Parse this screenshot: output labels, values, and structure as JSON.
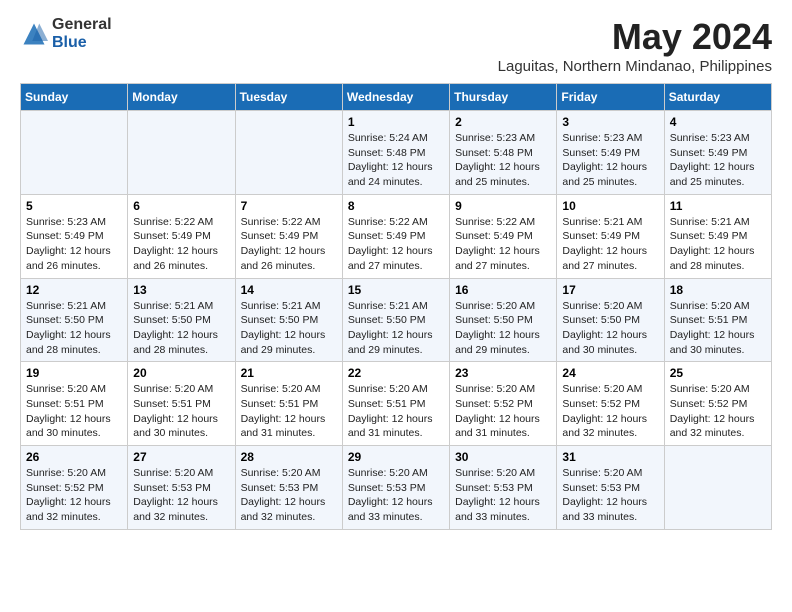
{
  "header": {
    "logo_general": "General",
    "logo_blue": "Blue",
    "month_title": "May 2024",
    "location": "Laguitas, Northern Mindanao, Philippines"
  },
  "days_of_week": [
    "Sunday",
    "Monday",
    "Tuesday",
    "Wednesday",
    "Thursday",
    "Friday",
    "Saturday"
  ],
  "weeks": [
    [
      {
        "day": "",
        "info": ""
      },
      {
        "day": "",
        "info": ""
      },
      {
        "day": "",
        "info": ""
      },
      {
        "day": "1",
        "info": "Sunrise: 5:24 AM\nSunset: 5:48 PM\nDaylight: 12 hours and 24 minutes."
      },
      {
        "day": "2",
        "info": "Sunrise: 5:23 AM\nSunset: 5:48 PM\nDaylight: 12 hours and 25 minutes."
      },
      {
        "day": "3",
        "info": "Sunrise: 5:23 AM\nSunset: 5:49 PM\nDaylight: 12 hours and 25 minutes."
      },
      {
        "day": "4",
        "info": "Sunrise: 5:23 AM\nSunset: 5:49 PM\nDaylight: 12 hours and 25 minutes."
      }
    ],
    [
      {
        "day": "5",
        "info": "Sunrise: 5:23 AM\nSunset: 5:49 PM\nDaylight: 12 hours and 26 minutes."
      },
      {
        "day": "6",
        "info": "Sunrise: 5:22 AM\nSunset: 5:49 PM\nDaylight: 12 hours and 26 minutes."
      },
      {
        "day": "7",
        "info": "Sunrise: 5:22 AM\nSunset: 5:49 PM\nDaylight: 12 hours and 26 minutes."
      },
      {
        "day": "8",
        "info": "Sunrise: 5:22 AM\nSunset: 5:49 PM\nDaylight: 12 hours and 27 minutes."
      },
      {
        "day": "9",
        "info": "Sunrise: 5:22 AM\nSunset: 5:49 PM\nDaylight: 12 hours and 27 minutes."
      },
      {
        "day": "10",
        "info": "Sunrise: 5:21 AM\nSunset: 5:49 PM\nDaylight: 12 hours and 27 minutes."
      },
      {
        "day": "11",
        "info": "Sunrise: 5:21 AM\nSunset: 5:49 PM\nDaylight: 12 hours and 28 minutes."
      }
    ],
    [
      {
        "day": "12",
        "info": "Sunrise: 5:21 AM\nSunset: 5:50 PM\nDaylight: 12 hours and 28 minutes."
      },
      {
        "day": "13",
        "info": "Sunrise: 5:21 AM\nSunset: 5:50 PM\nDaylight: 12 hours and 28 minutes."
      },
      {
        "day": "14",
        "info": "Sunrise: 5:21 AM\nSunset: 5:50 PM\nDaylight: 12 hours and 29 minutes."
      },
      {
        "day": "15",
        "info": "Sunrise: 5:21 AM\nSunset: 5:50 PM\nDaylight: 12 hours and 29 minutes."
      },
      {
        "day": "16",
        "info": "Sunrise: 5:20 AM\nSunset: 5:50 PM\nDaylight: 12 hours and 29 minutes."
      },
      {
        "day": "17",
        "info": "Sunrise: 5:20 AM\nSunset: 5:50 PM\nDaylight: 12 hours and 30 minutes."
      },
      {
        "day": "18",
        "info": "Sunrise: 5:20 AM\nSunset: 5:51 PM\nDaylight: 12 hours and 30 minutes."
      }
    ],
    [
      {
        "day": "19",
        "info": "Sunrise: 5:20 AM\nSunset: 5:51 PM\nDaylight: 12 hours and 30 minutes."
      },
      {
        "day": "20",
        "info": "Sunrise: 5:20 AM\nSunset: 5:51 PM\nDaylight: 12 hours and 30 minutes."
      },
      {
        "day": "21",
        "info": "Sunrise: 5:20 AM\nSunset: 5:51 PM\nDaylight: 12 hours and 31 minutes."
      },
      {
        "day": "22",
        "info": "Sunrise: 5:20 AM\nSunset: 5:51 PM\nDaylight: 12 hours and 31 minutes."
      },
      {
        "day": "23",
        "info": "Sunrise: 5:20 AM\nSunset: 5:52 PM\nDaylight: 12 hours and 31 minutes."
      },
      {
        "day": "24",
        "info": "Sunrise: 5:20 AM\nSunset: 5:52 PM\nDaylight: 12 hours and 32 minutes."
      },
      {
        "day": "25",
        "info": "Sunrise: 5:20 AM\nSunset: 5:52 PM\nDaylight: 12 hours and 32 minutes."
      }
    ],
    [
      {
        "day": "26",
        "info": "Sunrise: 5:20 AM\nSunset: 5:52 PM\nDaylight: 12 hours and 32 minutes."
      },
      {
        "day": "27",
        "info": "Sunrise: 5:20 AM\nSunset: 5:53 PM\nDaylight: 12 hours and 32 minutes."
      },
      {
        "day": "28",
        "info": "Sunrise: 5:20 AM\nSunset: 5:53 PM\nDaylight: 12 hours and 32 minutes."
      },
      {
        "day": "29",
        "info": "Sunrise: 5:20 AM\nSunset: 5:53 PM\nDaylight: 12 hours and 33 minutes."
      },
      {
        "day": "30",
        "info": "Sunrise: 5:20 AM\nSunset: 5:53 PM\nDaylight: 12 hours and 33 minutes."
      },
      {
        "day": "31",
        "info": "Sunrise: 5:20 AM\nSunset: 5:53 PM\nDaylight: 12 hours and 33 minutes."
      },
      {
        "day": "",
        "info": ""
      }
    ]
  ]
}
